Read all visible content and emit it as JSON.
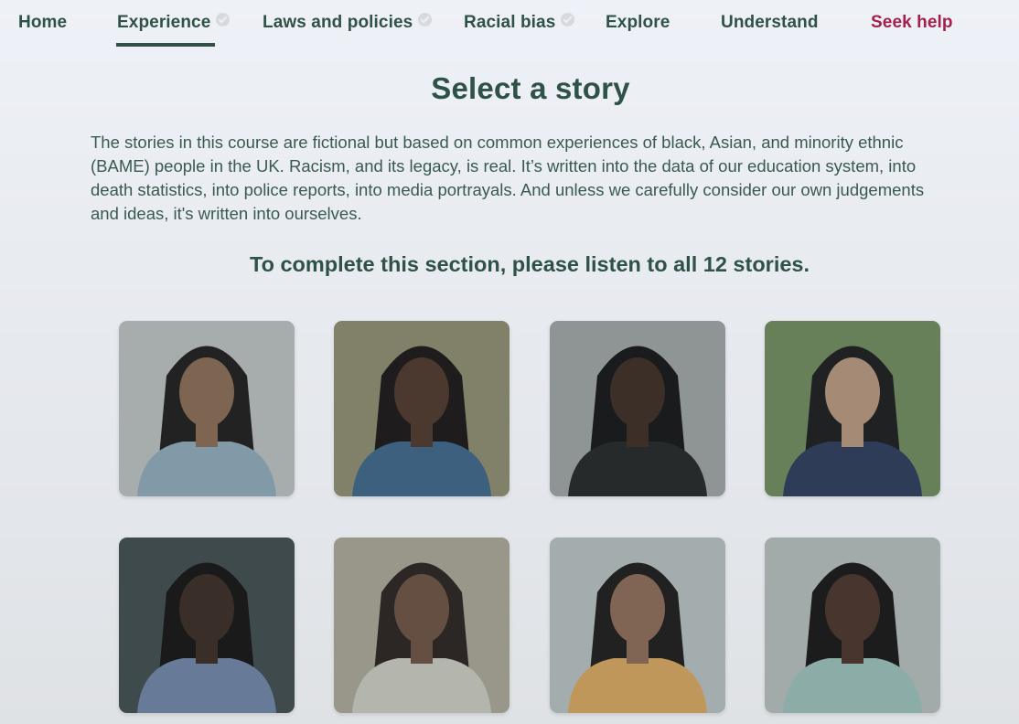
{
  "nav": {
    "items": [
      {
        "label": "Home",
        "completed": false,
        "active": false
      },
      {
        "label": "Experience",
        "completed": true,
        "active": true
      },
      {
        "label": "Laws and policies",
        "completed": true,
        "active": false
      },
      {
        "label": "Racial bias",
        "completed": true,
        "active": false
      },
      {
        "label": "Explore",
        "completed": false,
        "active": false
      },
      {
        "label": "Understand",
        "completed": false,
        "active": false
      },
      {
        "label": "Seek help",
        "completed": false,
        "active": false
      }
    ],
    "accent_color": "#2f5246",
    "help_color": "#a3204d"
  },
  "page": {
    "title": "Select a story",
    "intro": "The stories in this course are fictional but based on common experiences of black, Asian, and minority ethnic (BAME) people in the UK. Racism, and its legacy, is real. It’s written into the data of our education system, into death statistics, into police reports, into media portrayals. And unless we carefully consider our own judgements and ideas, it's written into ourselves.",
    "instruction": "To complete this section, please listen to all 12 stories."
  },
  "stories": [
    {
      "name": "story-portrait-1",
      "bg": "#b9bfbd",
      "skin": "#8a6a52",
      "hair": "#1e1c1c",
      "shirt": "#8fa9b8"
    },
    {
      "name": "story-portrait-2",
      "bg": "#8d8b6e",
      "skin": "#4e3528",
      "hair": "#1a1514",
      "shirt": "#3d6486"
    },
    {
      "name": "story-portrait-3",
      "bg": "#9ea3a2",
      "skin": "#3c2b22",
      "hair": "#151313",
      "shirt": "#232524"
    },
    {
      "name": "story-portrait-4",
      "bg": "#6f8a5c",
      "skin": "#b8977c",
      "hair": "#1b1a1a",
      "shirt": "#2c3a5a"
    },
    {
      "name": "story-portrait-5",
      "bg": "#3f4a4a",
      "skin": "#3a2a22",
      "hair": "#141212",
      "shirt": "#6f84a5"
    },
    {
      "name": "story-portrait-6",
      "bg": "#a8a594",
      "skin": "#6d5040",
      "hair": "#2a221e",
      "shirt": "#c9c8bd"
    },
    {
      "name": "story-portrait-7",
      "bg": "#b7bfbf",
      "skin": "#8e6a55",
      "hair": "#1e1a19",
      "shirt": "#d7a55c"
    },
    {
      "name": "story-portrait-8",
      "bg": "#b6bcba",
      "skin": "#4a3328",
      "hair": "#171414",
      "shirt": "#9bbfb7"
    }
  ]
}
